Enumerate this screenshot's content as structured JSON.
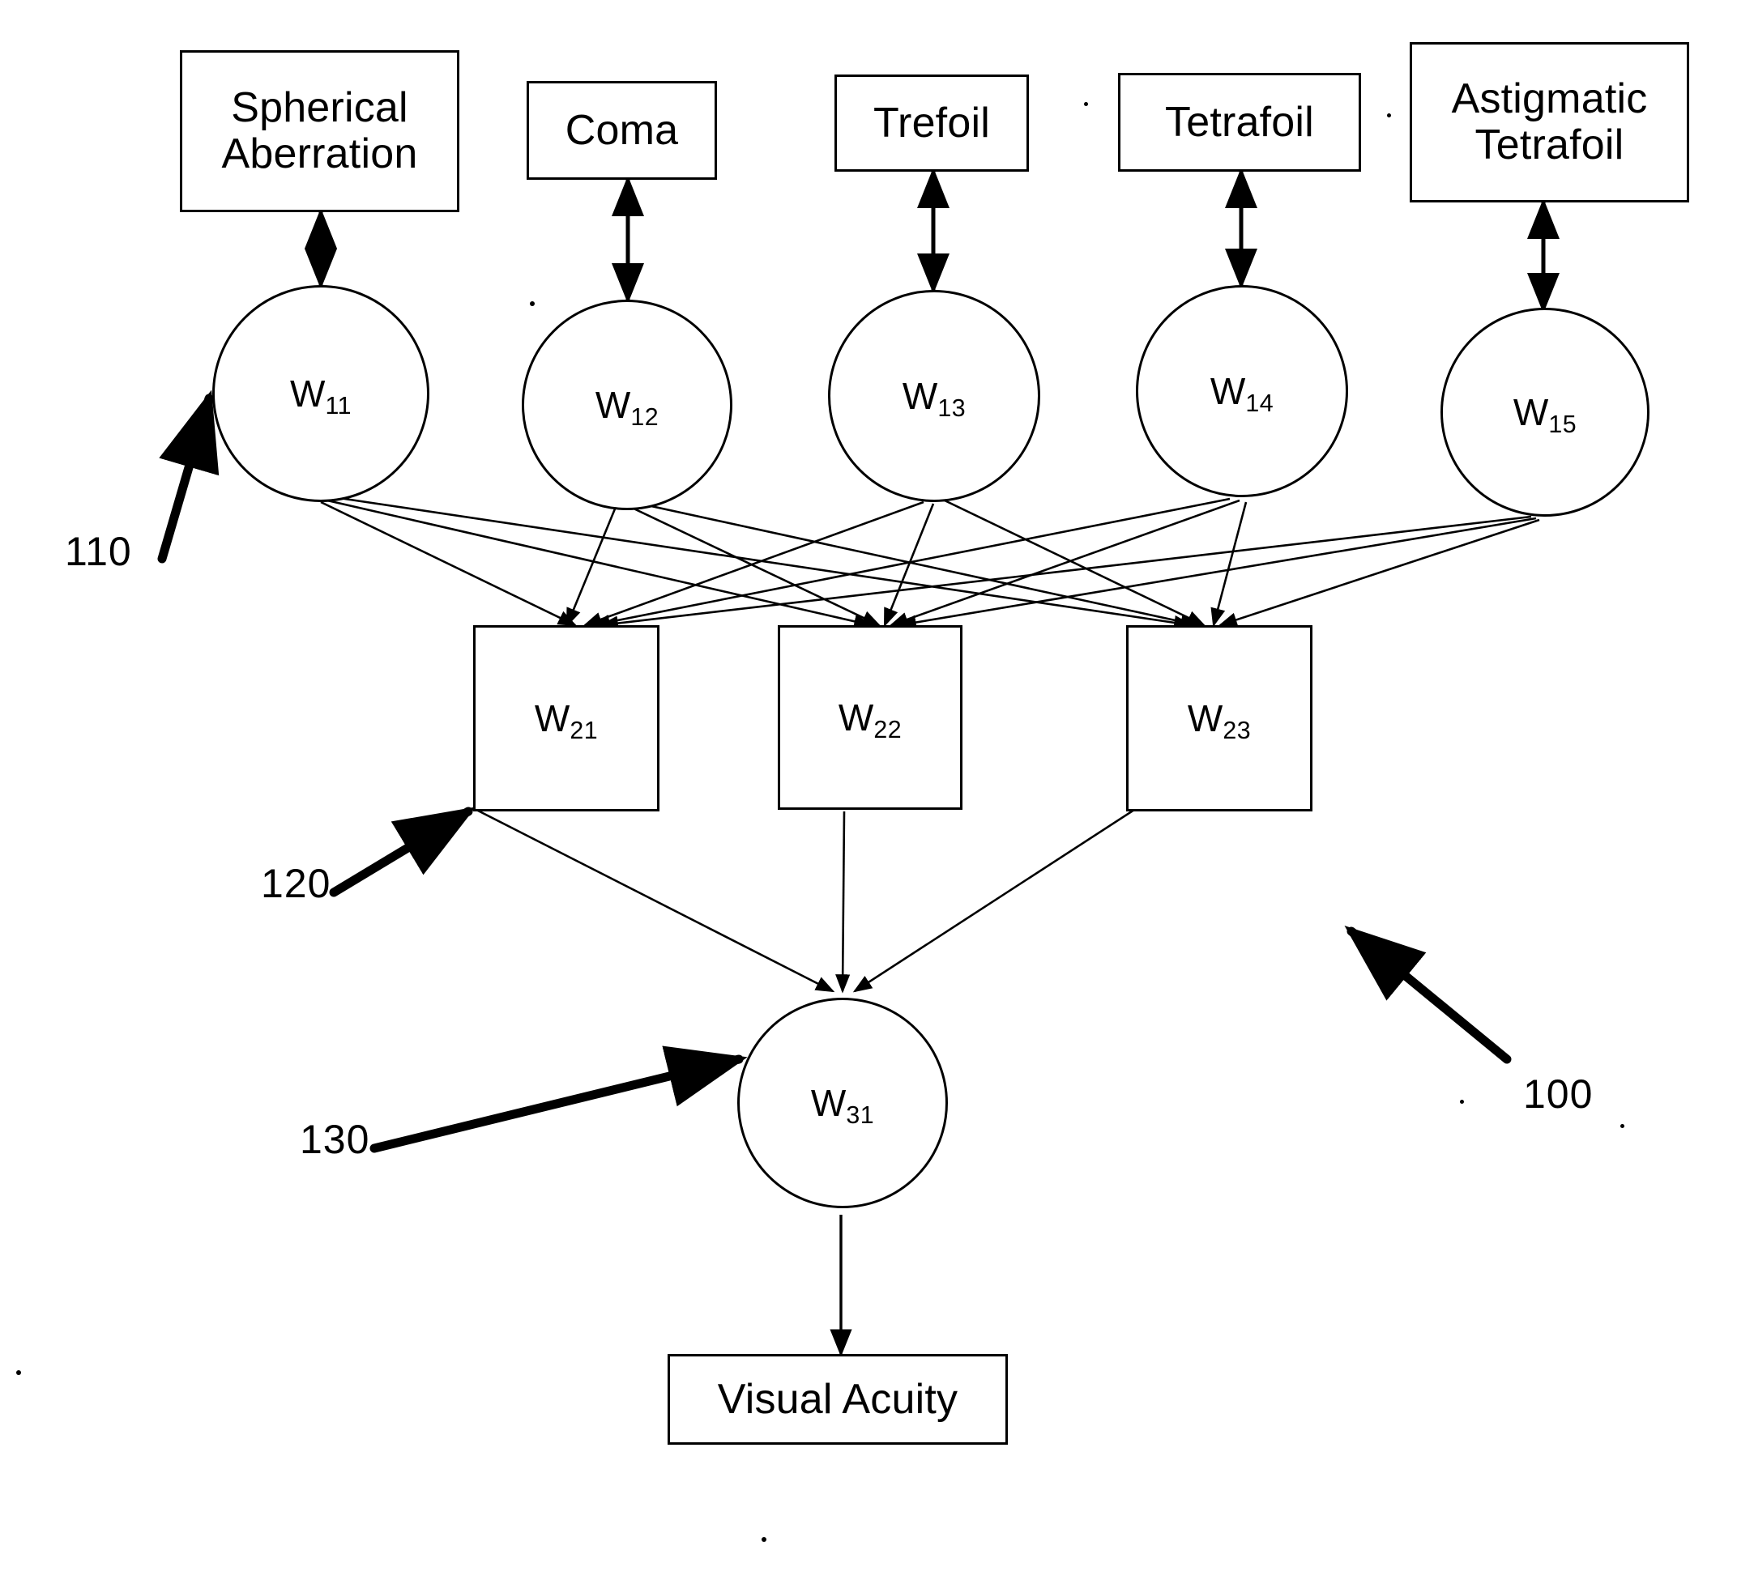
{
  "figure": {
    "title": "Neural network for predicting visual acuity from optical aberrations",
    "ink_color": "#000000",
    "background_color": "#ffffff"
  },
  "inputs": {
    "boxes": [
      {
        "id": "spherical-aberration",
        "label": "Spherical\nAberration",
        "line1": "Spherical",
        "line2": "Aberration"
      },
      {
        "id": "coma",
        "label": "Coma",
        "line1": "Coma",
        "line2": ""
      },
      {
        "id": "trefoil",
        "label": "Trefoil",
        "line1": "Trefoil",
        "line2": ""
      },
      {
        "id": "tetrafoil",
        "label": "Tetrafoil",
        "line1": "Tetrafoil",
        "line2": ""
      },
      {
        "id": "astigmatic-tetrafoil",
        "label": "Astigmatic\nTetrafoil",
        "line1": "Astigmatic",
        "line2": "Tetrafoil"
      }
    ]
  },
  "layers": {
    "input_layer": {
      "ref": "110",
      "shape": "circle",
      "nodes": [
        {
          "id": "w11",
          "base": "W",
          "sub": "11"
        },
        {
          "id": "w12",
          "base": "W",
          "sub": "12"
        },
        {
          "id": "w13",
          "base": "W",
          "sub": "13"
        },
        {
          "id": "w14",
          "base": "W",
          "sub": "14"
        },
        {
          "id": "w15",
          "base": "W",
          "sub": "15"
        }
      ]
    },
    "hidden_layer": {
      "ref": "120",
      "shape": "square",
      "nodes": [
        {
          "id": "w21",
          "base": "W",
          "sub": "21"
        },
        {
          "id": "w22",
          "base": "W",
          "sub": "22"
        },
        {
          "id": "w23",
          "base": "W",
          "sub": "23"
        }
      ]
    },
    "output_layer": {
      "ref": "130",
      "shape": "circle",
      "nodes": [
        {
          "id": "w31",
          "base": "W",
          "sub": "31"
        }
      ]
    }
  },
  "output": {
    "box": {
      "id": "visual-acuity",
      "label": "Visual Acuity"
    }
  },
  "reference_numerals": [
    {
      "id": "ref-110",
      "value": "110",
      "points_to": "input-layer-node-w11"
    },
    {
      "id": "ref-120",
      "value": "120",
      "points_to": "hidden-layer-node-w21"
    },
    {
      "id": "ref-130",
      "value": "130",
      "points_to": "output-layer-node-w31"
    },
    {
      "id": "ref-100",
      "value": "100",
      "points_to": "whole-network"
    }
  ]
}
